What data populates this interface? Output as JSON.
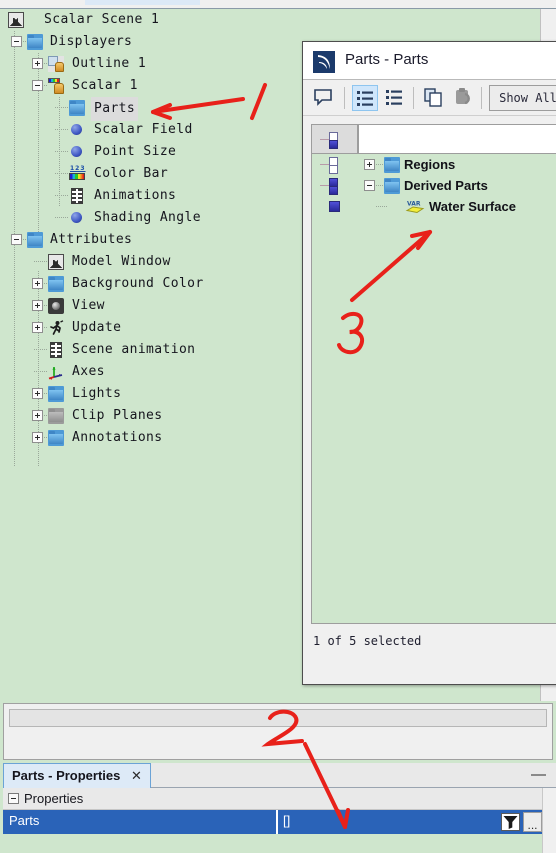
{
  "window": {
    "background_color": "#cfe6cd",
    "accent_color": "#2a63b8"
  },
  "tree": {
    "root": {
      "label": "Scalar Scene 1",
      "icon": "scene-icon"
    },
    "nodes": [
      {
        "label": "Displayers",
        "icon": "folder-icon",
        "expander": "minus",
        "depth": 1
      },
      {
        "label": "Outline 1",
        "icon": "outline-icon",
        "expander": "plus",
        "depth": 2
      },
      {
        "label": "Scalar 1",
        "icon": "scalar-icon",
        "expander": "minus",
        "depth": 2
      },
      {
        "label": "Parts",
        "icon": "folder-icon",
        "expander": "none",
        "depth": 3,
        "selected": true
      },
      {
        "label": "Scalar Field",
        "icon": "sphere-icon",
        "expander": "none",
        "depth": 3
      },
      {
        "label": "Point Size",
        "icon": "sphere-icon",
        "expander": "none",
        "depth": 3
      },
      {
        "label": "Color Bar",
        "icon": "colorbar-icon",
        "expander": "none",
        "depth": 3
      },
      {
        "label": "Animations",
        "icon": "film-icon",
        "expander": "none",
        "depth": 3
      },
      {
        "label": "Shading Angle",
        "icon": "sphere-icon",
        "expander": "none",
        "depth": 3
      },
      {
        "label": "Attributes",
        "icon": "folder-icon",
        "expander": "minus",
        "depth": 1
      },
      {
        "label": "Model Window",
        "icon": "scene-icon",
        "expander": "none",
        "depth": 2
      },
      {
        "label": "Background Color",
        "icon": "folder-icon",
        "expander": "plus",
        "depth": 2
      },
      {
        "label": "View",
        "icon": "camera-icon",
        "expander": "plus",
        "depth": 2
      },
      {
        "label": "Update",
        "icon": "runner-icon",
        "expander": "plus",
        "depth": 2
      },
      {
        "label": "Scene animation",
        "icon": "film-icon",
        "expander": "none",
        "depth": 2
      },
      {
        "label": "Axes",
        "icon": "axes-icon",
        "expander": "none",
        "depth": 2
      },
      {
        "label": "Lights",
        "icon": "folder-icon",
        "expander": "plus",
        "depth": 2
      },
      {
        "label": "Clip Planes",
        "icon": "folder-gray-icon",
        "expander": "plus",
        "depth": 2
      },
      {
        "label": "Annotations",
        "icon": "folder-icon",
        "expander": "plus",
        "depth": 2
      }
    ]
  },
  "dialog": {
    "title": "Parts - Parts",
    "logo_icon": "app-logo-icon",
    "toolbar": {
      "comment_icon": "comment-bubble-icon",
      "tree_view_icon": "tree-list-view-icon",
      "flat_view_icon": "flat-list-view-icon",
      "copy_icon": "copy-icon",
      "paste_icon": "paste-icon",
      "show_all_label": "Show All"
    },
    "tree": [
      {
        "label": "Regions",
        "expander": "plus",
        "icon": "folder-icon",
        "depth": 0,
        "state": "pair-empty"
      },
      {
        "label": "Derived Parts",
        "expander": "minus",
        "icon": "folder-icon",
        "depth": 0,
        "state": "pair-filled"
      },
      {
        "label": "Water Surface",
        "expander": "none",
        "icon": "var-surface-icon",
        "depth": 1,
        "state": "single-filled"
      }
    ],
    "status": "1 of 5 selected"
  },
  "filter_bar": {
    "value": "",
    "placeholder": ""
  },
  "properties": {
    "tab_label": "Parts - Properties",
    "close_icon": "close-icon",
    "minimize_icon": "minimize-icon",
    "section_label": "Properties",
    "rows": [
      {
        "name": "Parts",
        "value": "[]",
        "filter_icon": "funnel-icon",
        "more_label": "..."
      }
    ]
  },
  "annotations": [
    {
      "id": "1",
      "label": "1",
      "target": "tree-node-parts"
    },
    {
      "id": "2",
      "label": "2",
      "target": "filter-bar"
    },
    {
      "id": "3",
      "label": "3",
      "target": "dialog-node-water-surface"
    }
  ]
}
